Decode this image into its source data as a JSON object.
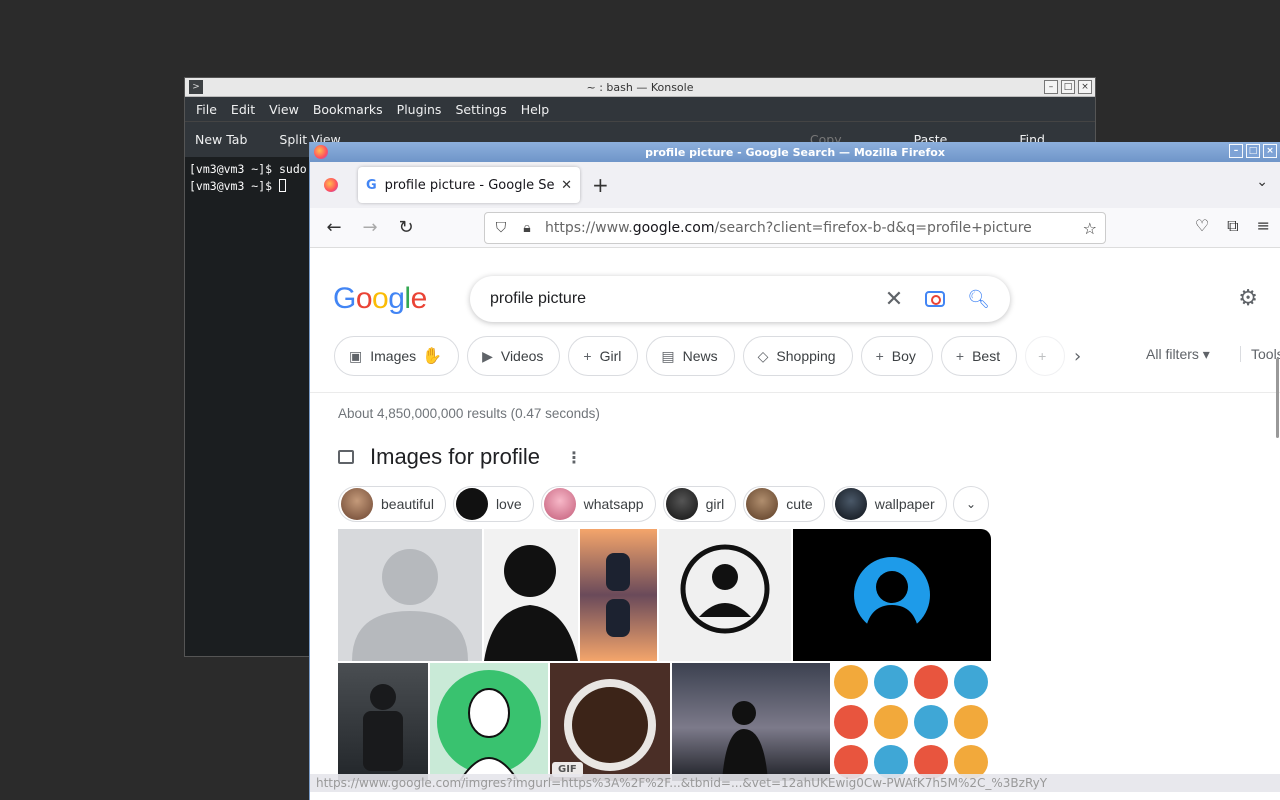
{
  "konsole": {
    "title": "~ : bash — Konsole",
    "menu": [
      "File",
      "Edit",
      "View",
      "Bookmarks",
      "Plugins",
      "Settings",
      "Help"
    ],
    "toolbar": {
      "new_tab": "New Tab",
      "split_view": "Split View",
      "copy": "Copy",
      "paste": "Paste",
      "find": "Find"
    },
    "lines": [
      "[vm3@vm3 ~]$ sudo",
      "[vm3@vm3 ~]$ "
    ]
  },
  "firefox": {
    "title": "profile picture - Google Search — Mozilla Firefox",
    "tab_title": "profile picture - Google Search",
    "url_prefix": "https://www.",
    "url_domain": "google.com",
    "url_rest": "/search?client=firefox-b-d&q=profile+picture"
  },
  "google": {
    "logo": [
      "G",
      "o",
      "o",
      "g",
      "l",
      "e"
    ],
    "query": "profile picture",
    "chips": [
      "Images",
      "Videos",
      "Girl",
      "News",
      "Shopping",
      "Boy",
      "Best"
    ],
    "all_filters": "All filters",
    "tools": "Tools",
    "stats": "About 4,850,000,000 results (0.47 seconds)",
    "section_title": "Images for profile",
    "refinements": [
      "beautiful",
      "love",
      "whatsapp",
      "girl",
      "cute",
      "wallpaper"
    ],
    "gif_badge": "GIF",
    "status_url": "https://www.google.com/imgres?imgurl=https%3A%2F%2F...&tbnid=...&vet=12ahUKEwig0Cw-PWAfK7h5M%2C_%3BzRyY"
  },
  "colors": {
    "google_blue": "#4285f4",
    "google_red": "#ea4335",
    "google_yellow": "#fbbc05",
    "google_green": "#34a853"
  }
}
